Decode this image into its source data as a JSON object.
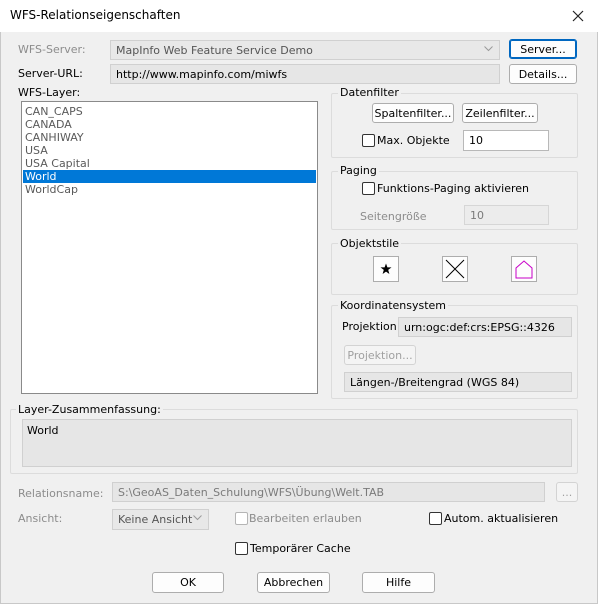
{
  "dialog": {
    "title": "WFS-Relationseigenschaften"
  },
  "server": {
    "label": "WFS-Server:",
    "value": "MapInfo Web Feature Service Demo",
    "button": "Server...",
    "url_label": "Server-URL:",
    "url_value": "http://www.mapinfo.com/miwfs",
    "details_button": "Details..."
  },
  "layers": {
    "label": "WFS-Layer:",
    "items": [
      "CAN_CAPS",
      "CANADA",
      "CANHIWAY",
      "USA",
      "USA Capital",
      "World",
      "WorldCap"
    ],
    "selected": "World"
  },
  "datenfilter": {
    "title": "Datenfilter",
    "spalten_button": "Spaltenfilter...",
    "zeilen_button": "Zeilenfilter...",
    "max_label": "Max. Objekte",
    "max_value": "10"
  },
  "paging": {
    "title": "Paging",
    "checkbox_label": "Funktions-Paging aktivieren",
    "size_label": "Seitengröße",
    "size_value": "10"
  },
  "objektstile": {
    "title": "Objektstile",
    "icons": [
      "point-style-icon",
      "line-style-icon",
      "region-style-icon"
    ]
  },
  "koordinaten": {
    "title": "Koordinatensystem",
    "proj_label": "Projektion:",
    "proj_value": "urn:ogc:def:crs:EPSG::4326",
    "proj_button": "Projektion...",
    "proj_name": "Längen-/Breitengrad (WGS 84)"
  },
  "summary": {
    "label": "Layer-Zusammenfassung:",
    "text": "World"
  },
  "relation": {
    "label": "Relationsname:",
    "value": "S:\\GeoAS_Daten_Schulung\\WFS\\Übung\\Welt.TAB",
    "browse": "..."
  },
  "ansicht": {
    "label": "Ansicht:",
    "value": "Keine Ansicht",
    "edit_label": "Bearbeiten erlauben",
    "auto_label": "Autom. aktualisieren"
  },
  "cache": {
    "label": "Temporärer Cache"
  },
  "buttons": {
    "ok": "OK",
    "cancel": "Abbrechen",
    "help": "Hilfe"
  },
  "colors": {
    "accent": "#0078d7",
    "default_border": "#0067c0",
    "region_icon": "#c800c8"
  }
}
